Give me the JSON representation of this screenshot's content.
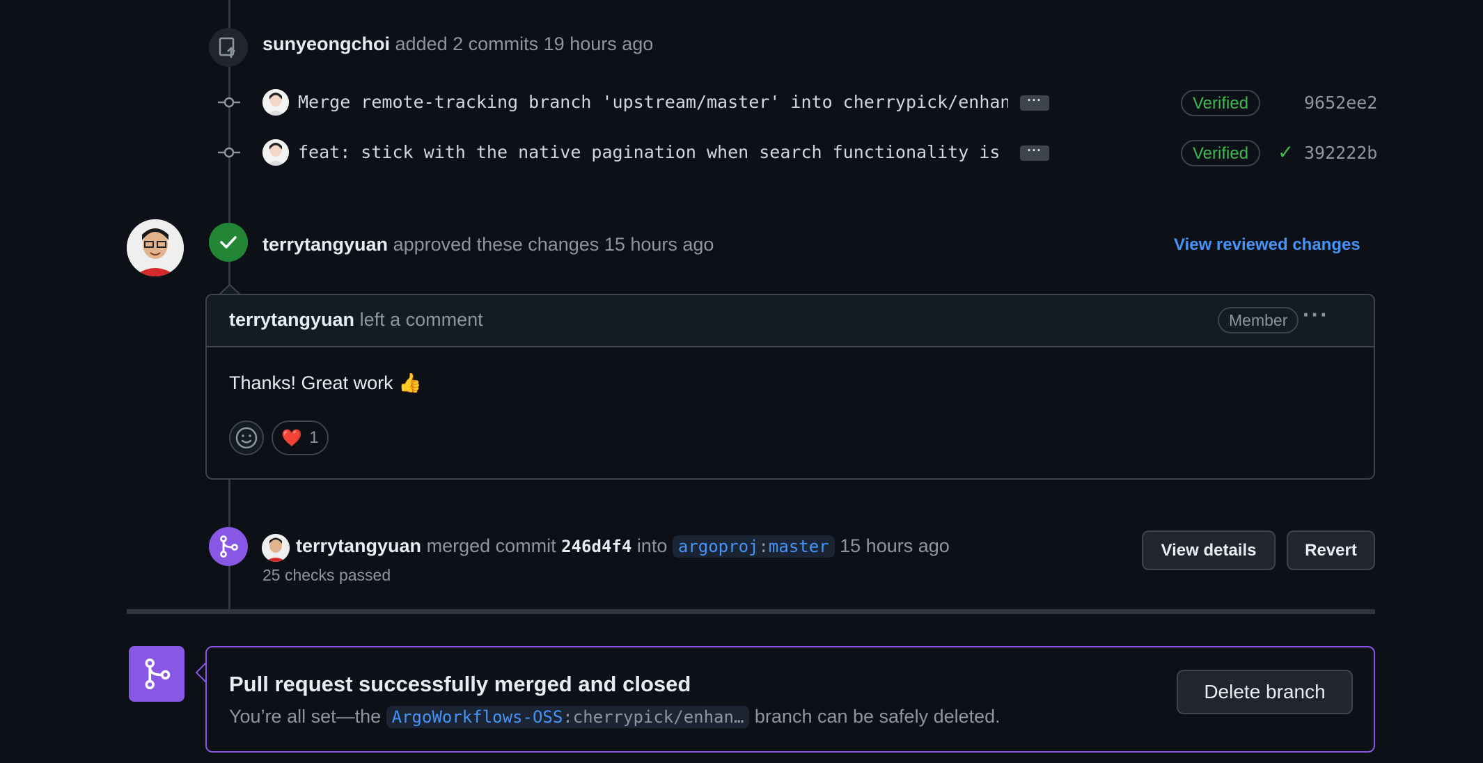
{
  "commits_event": {
    "author": "sunyeongchoi",
    "action": "added 2 commits",
    "time": "19 hours ago",
    "commits": [
      {
        "message": "Merge remote-tracking branch 'upstream/master' into cherrypick/enhanc…",
        "ellipsis": "···",
        "verified": "Verified",
        "check": "",
        "sha": "9652ee2"
      },
      {
        "message": "feat: stick with the native pagination when search functionality is n…",
        "ellipsis": "···",
        "verified": "Verified",
        "check": "✓",
        "sha": "392222b"
      }
    ]
  },
  "review_event": {
    "reviewer": "terrytangyuan",
    "action": "approved these changes",
    "time": "15 hours ago",
    "view_link": "View reviewed changes"
  },
  "comment": {
    "author": "terrytangyuan",
    "action": "left a comment",
    "role": "Member",
    "menu": "···",
    "body": "Thanks! Great work 👍",
    "reactions": [
      {
        "emoji": "❤️",
        "count": "1"
      }
    ]
  },
  "merge_event": {
    "author": "terrytangyuan",
    "action": "merged commit",
    "commit": "246d4f4",
    "into": "into",
    "target_owner": "argoproj",
    "target_sep": ":",
    "target_branch": "master",
    "time": "15 hours ago",
    "checks": "25 checks passed",
    "view_details": "View details",
    "revert": "Revert"
  },
  "merged_box": {
    "title": "Pull request successfully merged and closed",
    "text_before": "You’re all set—the",
    "branch_owner": "ArgoWorkflows-OSS",
    "branch_sep": ":",
    "branch_name": "cherrypick/enhan…",
    "text_after": "branch can be safely deleted.",
    "delete_button": "Delete branch"
  },
  "colors": {
    "background": "#0d1117",
    "approved_green": "#238636",
    "merged_purple": "#8957e5",
    "link_blue": "#4493f8",
    "verified_green": "#3fb950"
  }
}
